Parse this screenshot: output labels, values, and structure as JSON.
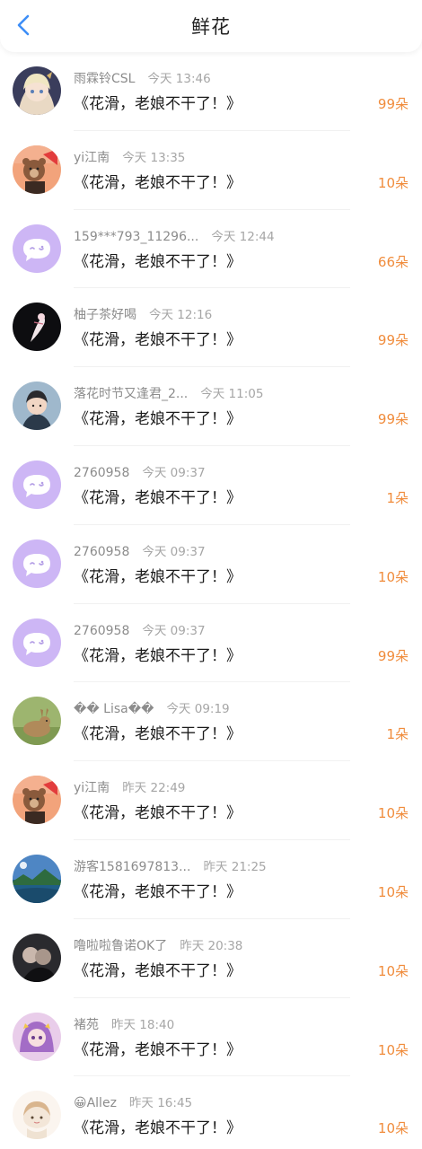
{
  "header": {
    "title": "鲜花"
  },
  "colors": {
    "count": "#f08c3c",
    "back": "#3d8ef7",
    "default_avatar": "#cdb6f5"
  },
  "rows": [
    {
      "name": "雨霖铃CSL",
      "time": "今天 13:46",
      "message": "《花滑，老娘不干了！》",
      "count": "99朵",
      "avatar": "anime-girl"
    },
    {
      "name": "yi江南",
      "time": "今天 13:35",
      "message": "《花滑，老娘不干了！》",
      "count": "10朵",
      "avatar": "bear-red"
    },
    {
      "name": "159***793_11296...",
      "time": "今天 12:44",
      "message": "《花滑，老娘不干了！》",
      "count": "66朵",
      "avatar": "default"
    },
    {
      "name": "柚子茶好喝",
      "time": "今天 12:16",
      "message": "《花滑，老娘不干了！》",
      "count": "99朵",
      "avatar": "dark-figure"
    },
    {
      "name": "落花时节又逢君_2...",
      "time": "今天 11:05",
      "message": "《花滑，老娘不干了！》",
      "count": "99朵",
      "avatar": "boy-portrait"
    },
    {
      "name": "2760958",
      "time": "今天 09:37",
      "message": "《花滑，老娘不干了！》",
      "count": "1朵",
      "avatar": "default"
    },
    {
      "name": "2760958",
      "time": "今天 09:37",
      "message": "《花滑，老娘不干了！》",
      "count": "10朵",
      "avatar": "default"
    },
    {
      "name": "2760958",
      "time": "今天 09:37",
      "message": "《花滑，老娘不干了！》",
      "count": "99朵",
      "avatar": "default"
    },
    {
      "name": "�� Lisa��",
      "time": "今天 09:19",
      "message": "《花滑，老娘不干了！》",
      "count": "1朵",
      "avatar": "rabbit"
    },
    {
      "name": "yi江南",
      "time": "昨天 22:49",
      "message": "《花滑，老娘不干了！》",
      "count": "10朵",
      "avatar": "bear-red"
    },
    {
      "name": "游客1581697813...",
      "time": "昨天 21:25",
      "message": "《花滑，老娘不干了！》",
      "count": "10朵",
      "avatar": "landscape"
    },
    {
      "name": "噜啦啦鲁诺OK了",
      "time": "昨天 20:38",
      "message": "《花滑，老娘不干了！》",
      "count": "10朵",
      "avatar": "dark-couple"
    },
    {
      "name": "褚苑",
      "time": "昨天 18:40",
      "message": "《花滑，老娘不干了！》",
      "count": "10朵",
      "avatar": "purple-girl"
    },
    {
      "name": "😀Allez",
      "time": "昨天 16:45",
      "message": "《花滑，老娘不干了！》",
      "count": "10朵",
      "avatar": "sketch-girl"
    }
  ]
}
